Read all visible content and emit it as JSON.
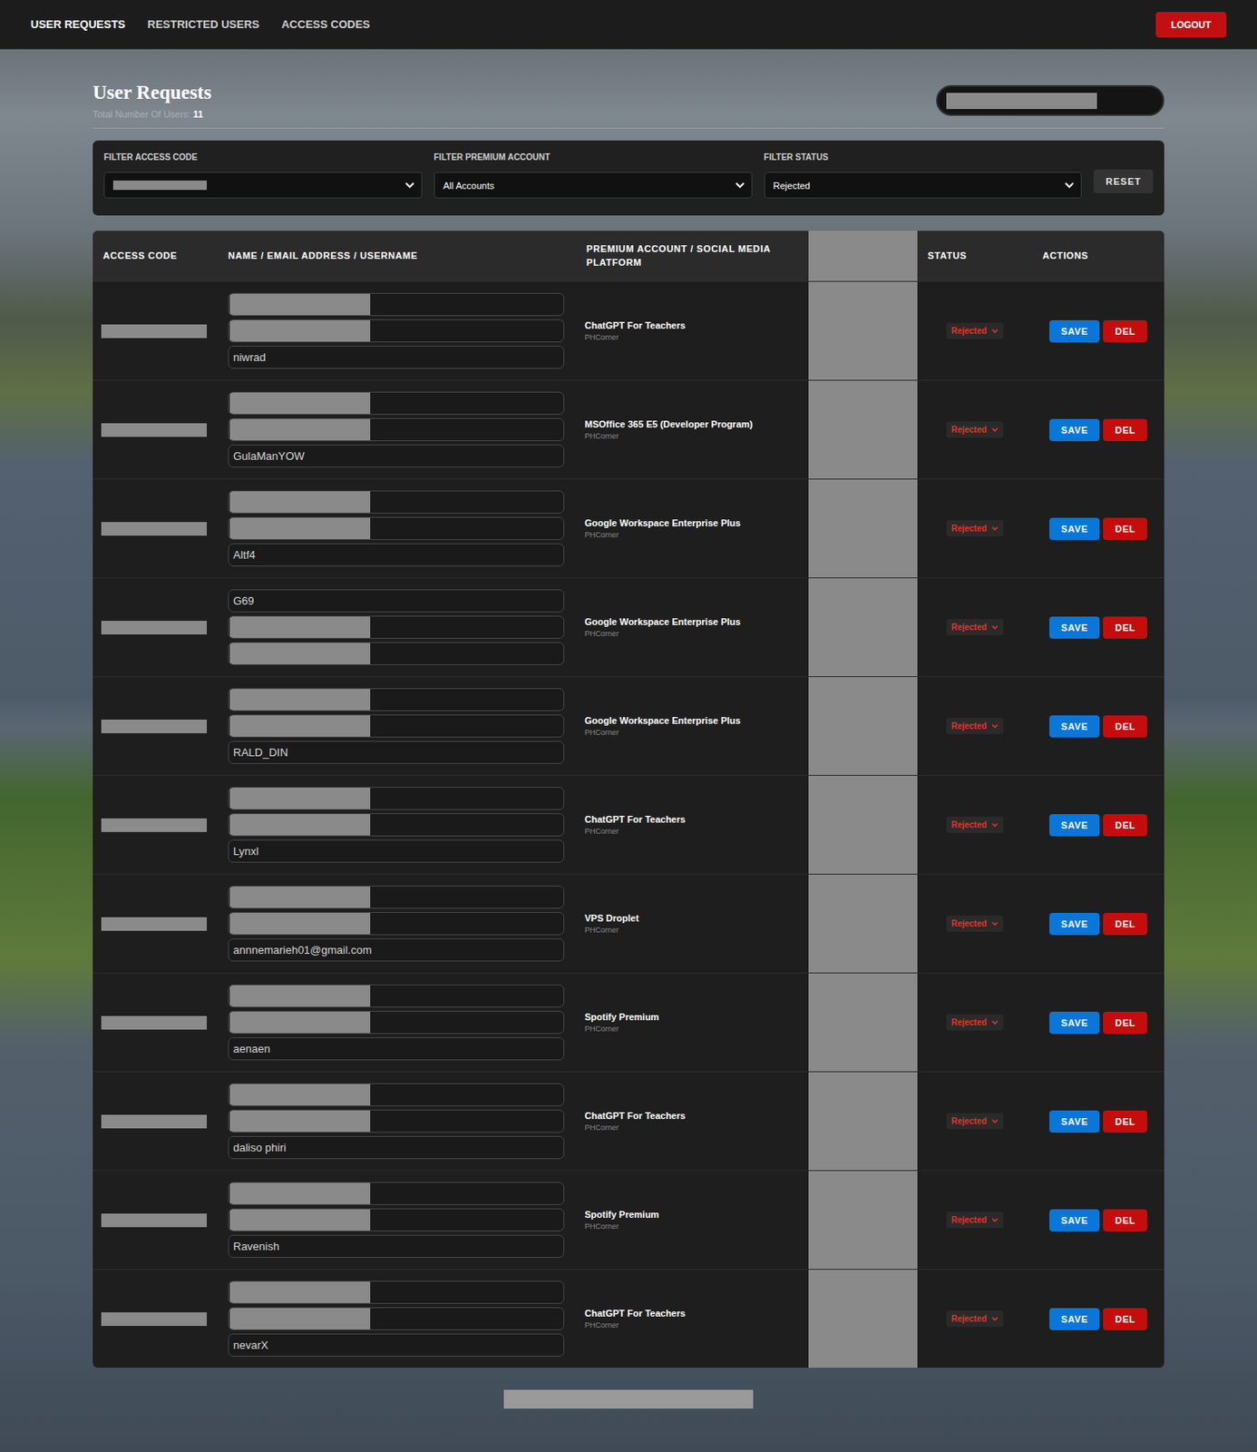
{
  "nav": {
    "items": [
      {
        "label": "USER REQUESTS",
        "selected": true
      },
      {
        "label": "RESTRICTED USERS",
        "selected": false
      },
      {
        "label": "ACCESS CODES",
        "selected": false
      }
    ],
    "logout": "LOGOUT"
  },
  "page": {
    "title": "User Requests",
    "count_label": "Total Number Of Users:",
    "count": "11"
  },
  "search": {
    "redacted": true
  },
  "filters": [
    {
      "label": "FILTER ACCESS CODE",
      "value": "",
      "redacted": true
    },
    {
      "label": "FILTER PREMIUM ACCOUNT",
      "value": "All Accounts",
      "redacted": false
    },
    {
      "label": "FILTER STATUS",
      "value": "Rejected",
      "redacted": false
    }
  ],
  "reset": "RESET",
  "table": {
    "columns": [
      {
        "label": "ACCESS CODE",
        "redacted": false
      },
      {
        "label": "NAME / EMAIL ADDRESS / USERNAME",
        "redacted": false
      },
      {
        "label": "PREMIUM ACCOUNT / SOCIAL MEDIA PLATFORM",
        "redacted": false
      },
      {
        "label": "",
        "redacted": true
      },
      {
        "label": "STATUS",
        "redacted": false
      },
      {
        "label": "ACTIONS",
        "redacted": false
      }
    ],
    "actions": {
      "save": "SAVE",
      "delete": "DEL"
    },
    "rows": [
      {
        "access_code_redacted": true,
        "fields": [
          {
            "value": "",
            "redacted": true
          },
          {
            "value": "",
            "redacted": true
          },
          {
            "value": "niwrad",
            "redacted": false
          }
        ],
        "account": "ChatGPT For Teachers",
        "platform": "PHCorner",
        "status": "Rejected"
      },
      {
        "access_code_redacted": true,
        "fields": [
          {
            "value": "",
            "redacted": true
          },
          {
            "value": "",
            "redacted": true
          },
          {
            "value": "GulaManYOW",
            "redacted": false
          }
        ],
        "account": "MSOffice 365 E5 (Developer Program)",
        "platform": "PHCorner",
        "status": "Rejected"
      },
      {
        "access_code_redacted": true,
        "fields": [
          {
            "value": "",
            "redacted": true
          },
          {
            "value": "",
            "redacted": true
          },
          {
            "value": "Altf4",
            "redacted": false
          }
        ],
        "account": "Google Workspace Enterprise Plus",
        "platform": "PHCorner",
        "status": "Rejected"
      },
      {
        "access_code_redacted": true,
        "fields": [
          {
            "value": "G69",
            "redacted": false
          },
          {
            "value": "",
            "redacted": true
          },
          {
            "value": "",
            "redacted": true
          }
        ],
        "account": "Google Workspace Enterprise Plus",
        "platform": "PHCorner",
        "status": "Rejected"
      },
      {
        "access_code_redacted": true,
        "fields": [
          {
            "value": "",
            "redacted": true
          },
          {
            "value": "",
            "redacted": true
          },
          {
            "value": "RALD_DIN",
            "redacted": false
          }
        ],
        "account": "Google Workspace Enterprise Plus",
        "platform": "PHCorner",
        "status": "Rejected"
      },
      {
        "access_code_redacted": true,
        "fields": [
          {
            "value": "",
            "redacted": true
          },
          {
            "value": "",
            "redacted": true
          },
          {
            "value": "Lynxl",
            "redacted": false
          }
        ],
        "account": "ChatGPT For Teachers",
        "platform": "PHCorner",
        "status": "Rejected"
      },
      {
        "access_code_redacted": true,
        "fields": [
          {
            "value": "",
            "redacted": true
          },
          {
            "value": "",
            "redacted": true
          },
          {
            "value": "annnemarieh01@gmail.com",
            "redacted": false
          }
        ],
        "account": "VPS Droplet",
        "platform": "PHCorner",
        "status": "Rejected"
      },
      {
        "access_code_redacted": true,
        "fields": [
          {
            "value": "",
            "redacted": true
          },
          {
            "value": "",
            "redacted": true
          },
          {
            "value": "aenaen",
            "redacted": false
          }
        ],
        "account": "Spotify Premium",
        "platform": "PHCorner",
        "status": "Rejected"
      },
      {
        "access_code_redacted": true,
        "fields": [
          {
            "value": "",
            "redacted": true
          },
          {
            "value": "",
            "redacted": true
          },
          {
            "value": "daliso phiri",
            "redacted": false
          }
        ],
        "account": "ChatGPT For Teachers",
        "platform": "PHCorner",
        "status": "Rejected"
      },
      {
        "access_code_redacted": true,
        "fields": [
          {
            "value": "",
            "redacted": true
          },
          {
            "value": "",
            "redacted": true
          },
          {
            "value": "Ravenish",
            "redacted": false
          }
        ],
        "account": "Spotify Premium",
        "platform": "PHCorner",
        "status": "Rejected"
      },
      {
        "access_code_redacted": true,
        "fields": [
          {
            "value": "",
            "redacted": true
          },
          {
            "value": "",
            "redacted": true
          },
          {
            "value": "nevarX",
            "redacted": false
          }
        ],
        "account": "ChatGPT For Teachers",
        "platform": "PHCorner",
        "status": "Rejected"
      }
    ]
  },
  "footer": {
    "redacted": true
  }
}
